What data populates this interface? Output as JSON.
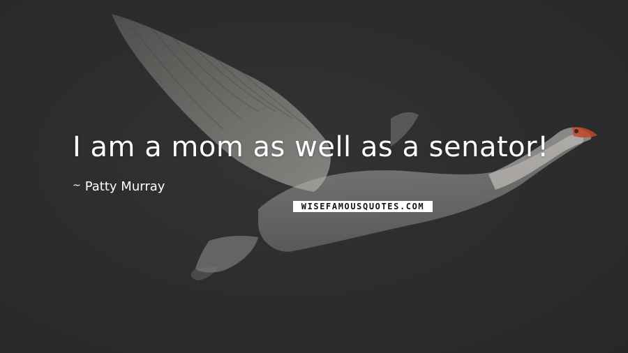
{
  "background_color": "#2b2c2e",
  "quote": {
    "text": "I am a mom as well as a senator!",
    "color": "#ffffff"
  },
  "author": {
    "prefix": "~",
    "name": "Patty Murray"
  },
  "watermark": {
    "text": "WISEFAMOUSQUOTES.COM"
  },
  "background_image": {
    "subject": "white swan flying"
  }
}
